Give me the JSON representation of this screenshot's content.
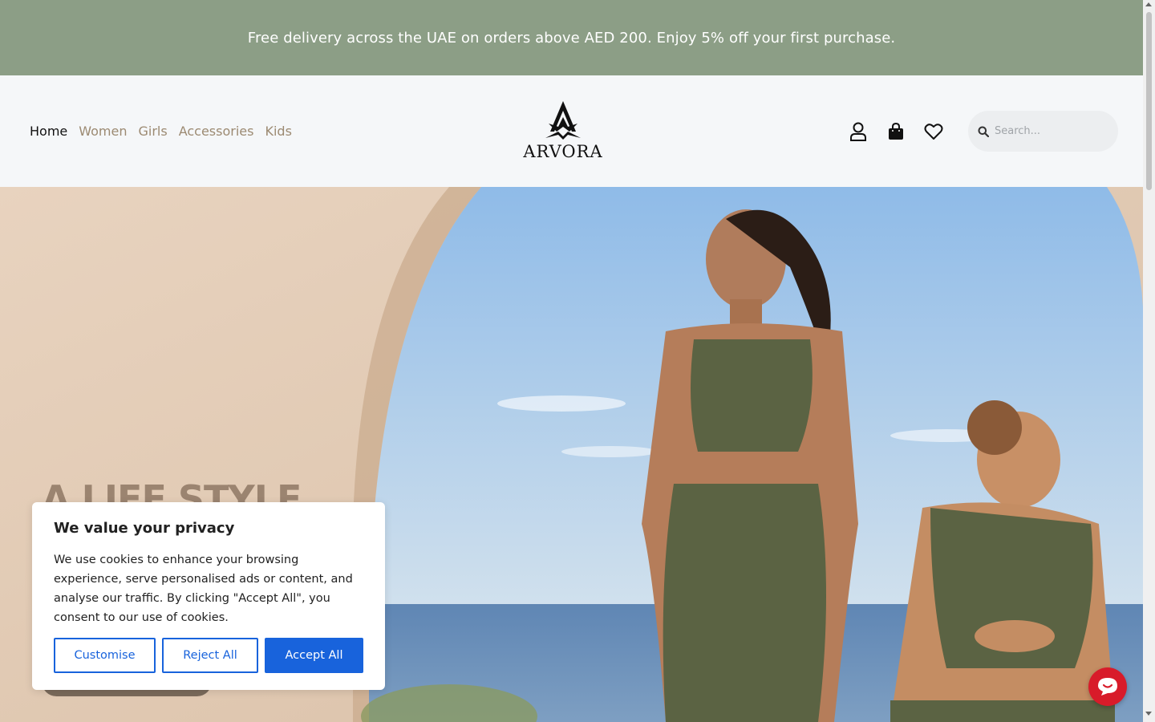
{
  "announcement": {
    "text": "Free delivery across the UAE on orders above AED 200. Enjoy 5% off your first purchase."
  },
  "nav": {
    "items": [
      {
        "label": "Home",
        "active": true
      },
      {
        "label": "Women",
        "active": false
      },
      {
        "label": "Girls",
        "active": false
      },
      {
        "label": "Accessories",
        "active": false
      },
      {
        "label": "Kids",
        "active": false
      }
    ]
  },
  "brand": {
    "name": "ARVORA"
  },
  "header_icons": [
    "user-icon",
    "shopping-bag-icon",
    "heart-icon"
  ],
  "search": {
    "placeholder": "Search..."
  },
  "hero": {
    "title": "A LIFE STYLE"
  },
  "cookie_banner": {
    "title": "We value your privacy",
    "body": "We use cookies to enhance your browsing experience, serve personalised ads or content, and analyse our traffic. By clicking \"Accept All\", you consent to our use of cookies.",
    "customise_label": "Customise",
    "reject_label": "Reject All",
    "accept_label": "Accept All"
  },
  "colors": {
    "announcement_bg": "#8c9e86",
    "nav_link": "#9c8a72",
    "cookie_accent": "#1863dc",
    "chat_button": "#d81b2a"
  }
}
